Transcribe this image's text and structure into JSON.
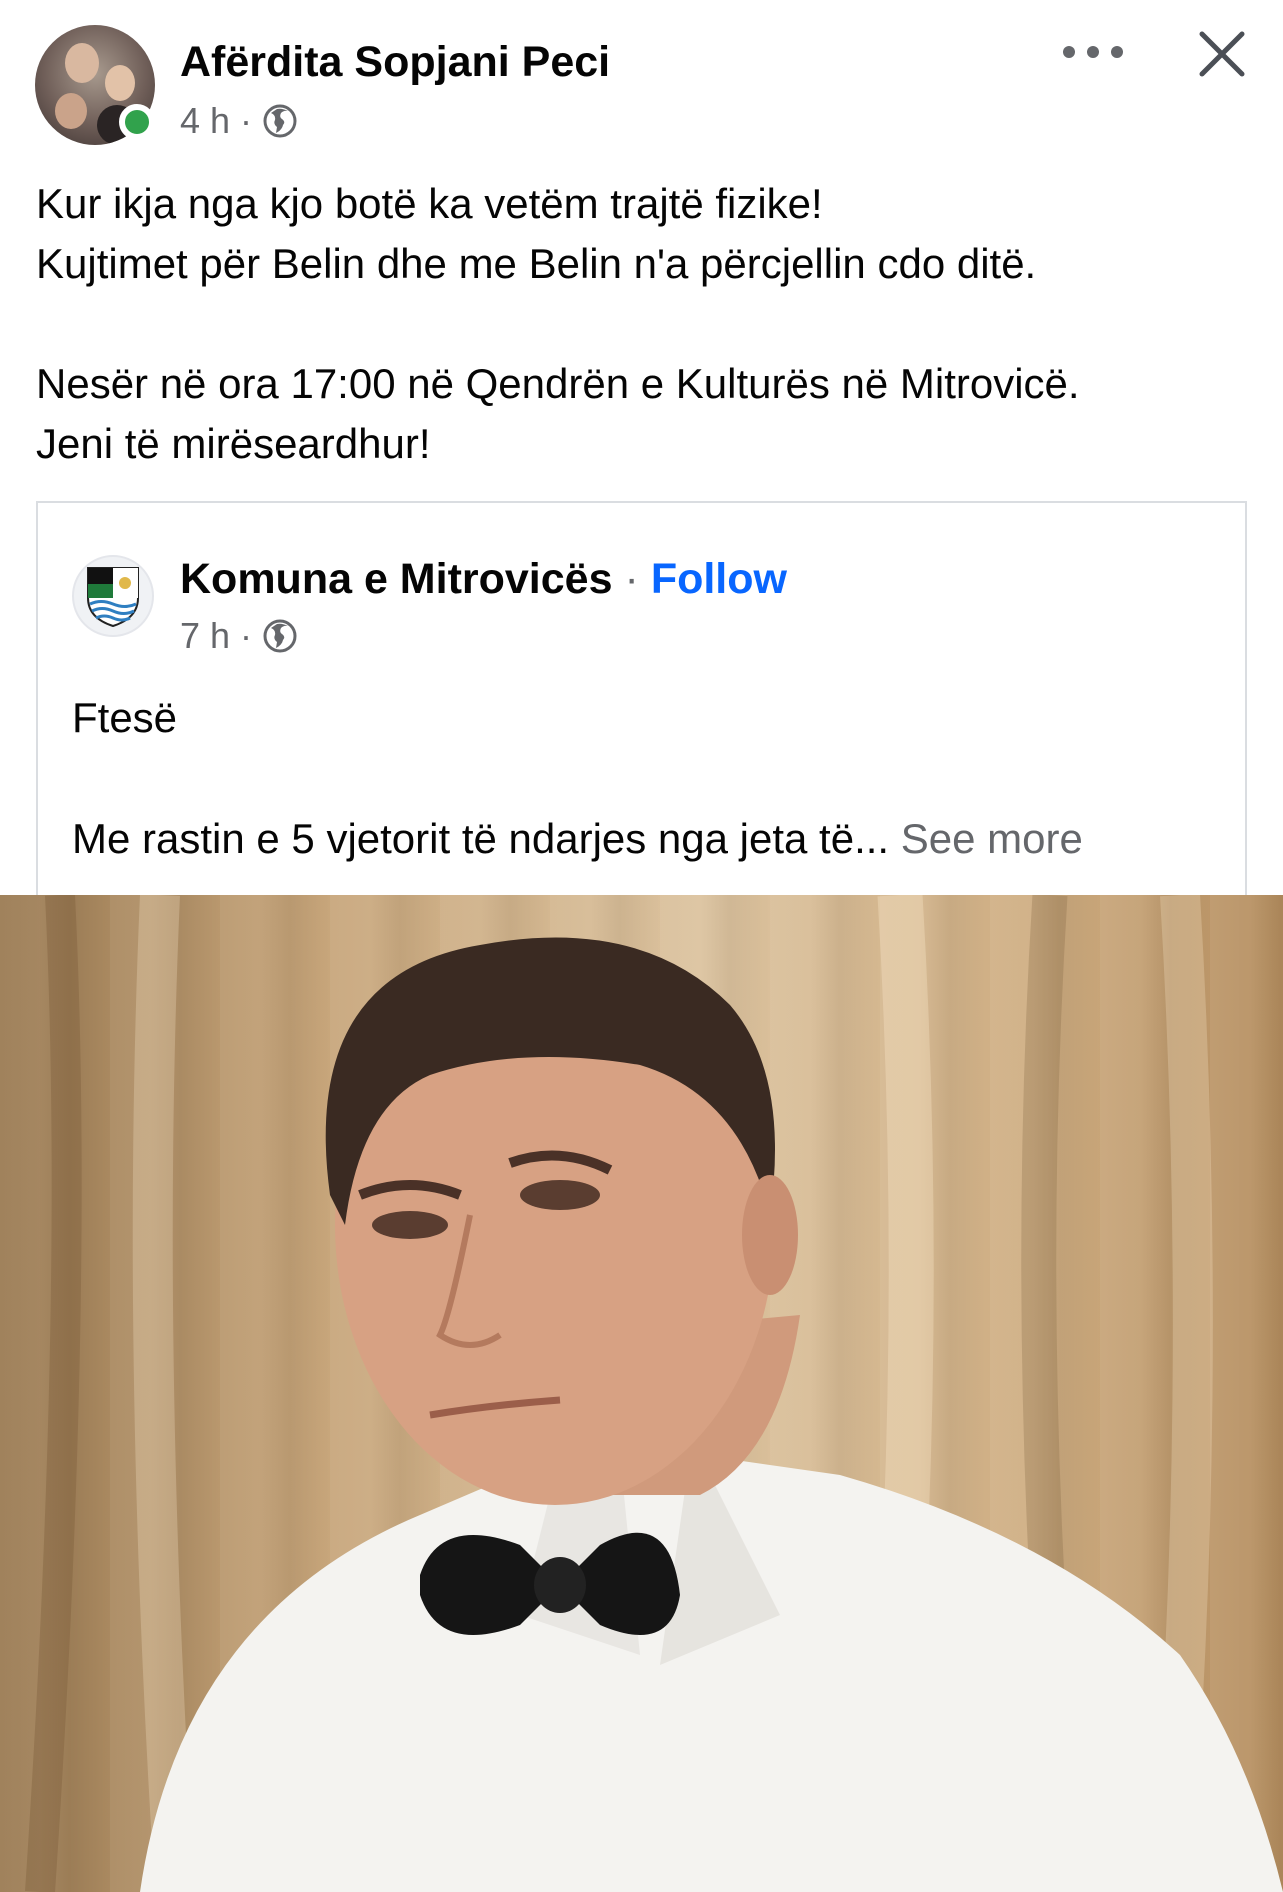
{
  "post": {
    "author": "Afërdita Sopjani Peci",
    "time": "4 h",
    "separator": "·",
    "audience_icon": "globe-icon",
    "text_lines": [
      "Kur ikja nga kjo botë ka vetëm trajtë fizike!",
      "Kujtimet për Belin dhe me Belin n'a përcjellin cdo ditë.",
      "Nesër në ora 17:00 në Qendrën e Kulturës në Mitrovicë.",
      "Jeni të mirëseardhur!"
    ]
  },
  "shared": {
    "page_name": "Komuna e Mitrovicës",
    "separator": "·",
    "follow_label": "Follow",
    "time": "7 h",
    "title": "Ftesë",
    "description": "Me rastin e 5 vjetorit të ndarjes nga jeta të...",
    "see_more_label": "See more"
  },
  "icons": {
    "more": "more-options-icon",
    "close": "close-icon"
  },
  "colors": {
    "link": "#0866ff",
    "secondary_text": "#65676b",
    "online": "#31a24c"
  }
}
